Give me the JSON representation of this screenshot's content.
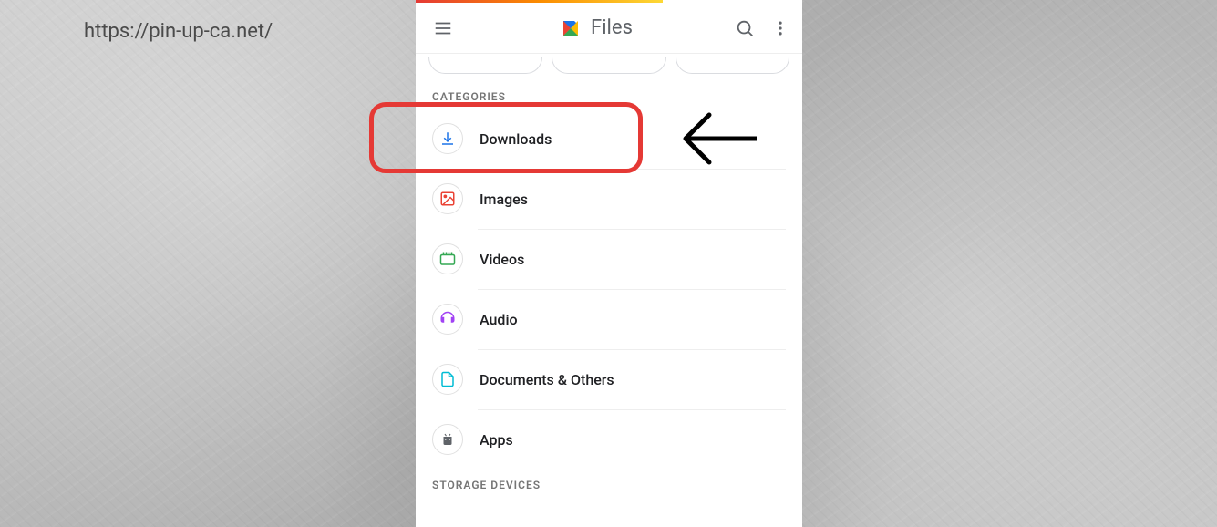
{
  "url_overlay": "https://pin-up-ca.net/",
  "app": {
    "title": "Files"
  },
  "sections": {
    "categories_header": "Categories",
    "storage_header": "Storage Devices"
  },
  "categories": [
    {
      "label": "Downloads",
      "icon": "download"
    },
    {
      "label": "Images",
      "icon": "image"
    },
    {
      "label": "Videos",
      "icon": "video"
    },
    {
      "label": "Audio",
      "icon": "audio"
    },
    {
      "label": "Documents & Others",
      "icon": "document"
    },
    {
      "label": "Apps",
      "icon": "apps"
    }
  ]
}
